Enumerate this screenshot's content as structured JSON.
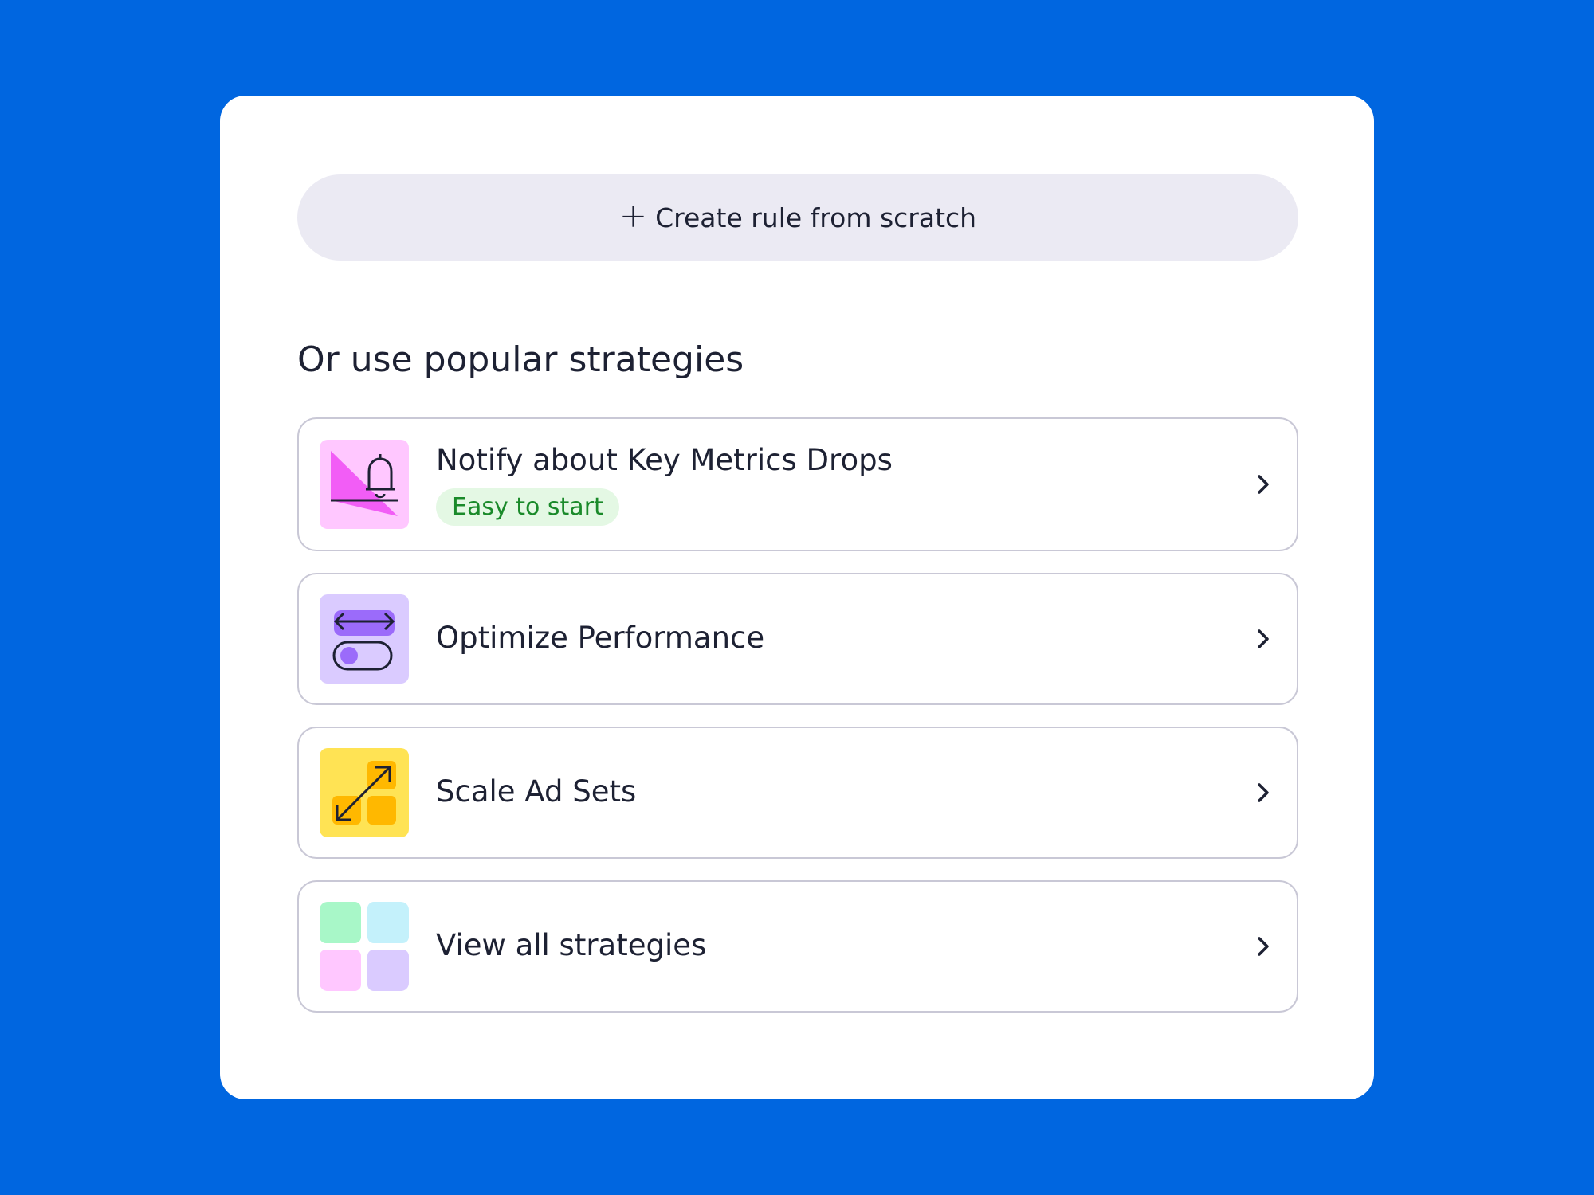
{
  "create_button": {
    "icon": "plus-icon",
    "label": "Create rule from scratch"
  },
  "section_title": "Or use popular strategies",
  "strategies": [
    {
      "label": "Notify about Key Metrics Drops",
      "badge": "Easy to start",
      "icon": "metrics-drop-bell-icon",
      "tile_color": "#FFC7FF"
    },
    {
      "label": "Optimize Performance",
      "icon": "toggle-optimize-icon",
      "tile_color": "#DACBFF"
    },
    {
      "label": "Scale Ad Sets",
      "icon": "scale-arrows-icon",
      "tile_color": "#FFE354"
    },
    {
      "label": "View all strategies",
      "icon": "grid-tiles-icon",
      "tile_colors": [
        "#A8F7C8",
        "#C4F1FB",
        "#FFC7FF",
        "#DACBFF"
      ]
    }
  ],
  "colors": {
    "background": "#0066E0",
    "card": "#FFFFFF",
    "button_fill": "#EBEAF3",
    "badge_bg": "#E4F8E4",
    "badge_text": "#1A8A2A"
  }
}
